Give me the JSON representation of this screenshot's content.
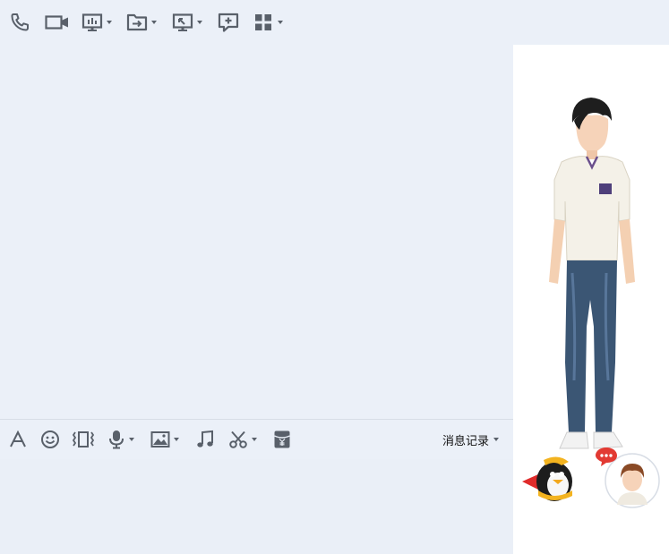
{
  "top_toolbar": {
    "buttons": [
      {
        "icon": "phone-icon",
        "has_dropdown": false
      },
      {
        "icon": "video-camera-icon",
        "has_dropdown": false
      },
      {
        "icon": "screen-share-icon",
        "has_dropdown": true
      },
      {
        "icon": "file-transfer-icon",
        "has_dropdown": true
      },
      {
        "icon": "remote-desktop-icon",
        "has_dropdown": true
      },
      {
        "icon": "add-comment-icon",
        "has_dropdown": false
      },
      {
        "icon": "apps-grid-icon",
        "has_dropdown": true
      }
    ]
  },
  "input_toolbar": {
    "buttons": [
      {
        "icon": "font-icon",
        "has_dropdown": false
      },
      {
        "icon": "emoji-icon",
        "has_dropdown": false
      },
      {
        "icon": "shake-window-icon",
        "has_dropdown": false
      },
      {
        "icon": "microphone-icon",
        "has_dropdown": true
      },
      {
        "icon": "image-icon",
        "has_dropdown": true
      },
      {
        "icon": "music-note-icon",
        "has_dropdown": false
      },
      {
        "icon": "scissors-icon",
        "has_dropdown": true
      },
      {
        "icon": "red-packet-icon",
        "has_dropdown": false
      }
    ],
    "history_label": "消息记录"
  },
  "colors": {
    "background": "#ebf0f8",
    "icon": "#59606a",
    "side_panel": "#ffffff"
  }
}
